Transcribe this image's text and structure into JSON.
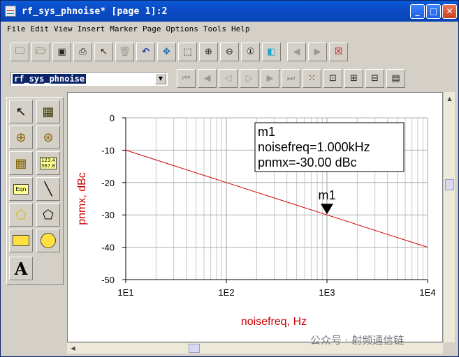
{
  "window": {
    "title": "rf_sys_phnoise* [page 1]:2"
  },
  "menu": [
    "File",
    "Edit",
    "View",
    "Insert",
    "Marker",
    "Page",
    "Options",
    "Tools",
    "Help"
  ],
  "toolbar2": {
    "dataset_value": "rf_sys_phnoise"
  },
  "palette": {
    "text_tool": "A",
    "eqn_label": "Eqn",
    "table_label": "123.4 567.8"
  },
  "chart_data": {
    "type": "line",
    "xscale": "log",
    "xlim": [
      10,
      10000
    ],
    "ylim": [
      -50,
      0
    ],
    "xticks": [
      "1E1",
      "1E2",
      "1E3",
      "1E4"
    ],
    "yticks": [
      "0",
      "-10",
      "-20",
      "-30",
      "-40",
      "-50"
    ],
    "xlabel": "noisefreq, Hz",
    "ylabel": "pnmx, dBc",
    "grid": true,
    "series": [
      {
        "x": [
          10,
          100,
          1000,
          10000
        ],
        "values": [
          -10,
          -20,
          -30,
          -40
        ],
        "color": "#d00000"
      }
    ],
    "marker": {
      "name": "m1",
      "x": 1000,
      "y": -30,
      "lines": [
        "m1",
        "noisefreq=1.000kHz",
        "pnmx=-30.00 dBc"
      ]
    }
  },
  "watermark": "公众号 · 射频通信链",
  "colors": {
    "titlebar": "#0b4cc8",
    "axis_label": "#cc0000",
    "trace": "#d00000"
  }
}
